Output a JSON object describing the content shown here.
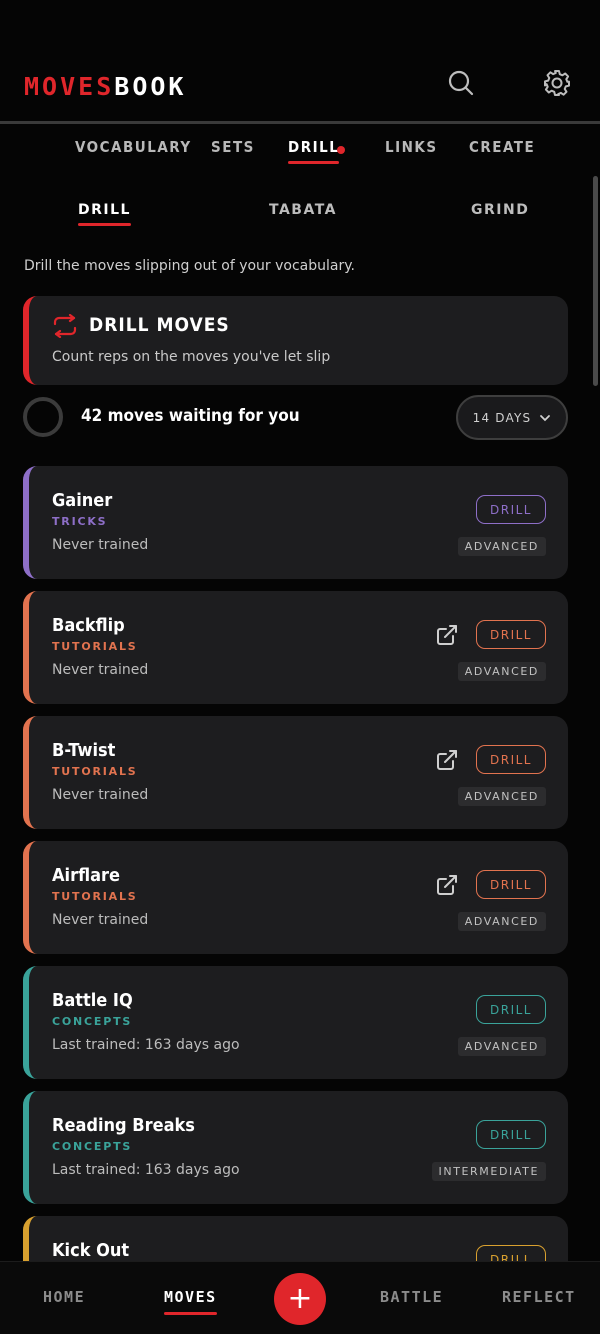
{
  "app": {
    "logo_red": "MOVES",
    "logo_white": "BOOK"
  },
  "header": {
    "search_icon": "search-icon",
    "settings_icon": "gear-icon"
  },
  "main_tabs": [
    {
      "label": "VOCABULARY"
    },
    {
      "label": "SETS"
    },
    {
      "label": "DRILL",
      "active": true,
      "badge": "dot"
    },
    {
      "label": "LINKS"
    },
    {
      "label": "CREATE"
    }
  ],
  "sub_tabs": [
    {
      "label": "DRILL",
      "active": true
    },
    {
      "label": "TABATA"
    },
    {
      "label": "GRIND"
    }
  ],
  "intro": "Drill the moves slipping out of your vocabulary.",
  "hero": {
    "title": "DRILL MOVES",
    "subtitle": "Count reps on the moves you've let slip",
    "icon": "repeat-icon"
  },
  "waiting": {
    "text": "42 moves waiting for you",
    "days_filter": "14 DAYS"
  },
  "colors": {
    "accent": "#e0262b",
    "tricks": "#8e6fc8",
    "tutorials": "#e2734f",
    "concepts": "#3aa39a",
    "footwork": "#d9a12f"
  },
  "moves": [
    {
      "name": "Gainer",
      "category": "TRICKS",
      "meta": "Never trained",
      "level": "ADVANCED",
      "drill": "DRILL",
      "external": false,
      "color": "#8e6fc8"
    },
    {
      "name": "Backflip",
      "category": "TUTORIALS",
      "meta": "Never trained",
      "level": "ADVANCED",
      "drill": "DRILL",
      "external": true,
      "color": "#e2734f"
    },
    {
      "name": "B-Twist",
      "category": "TUTORIALS",
      "meta": "Never trained",
      "level": "ADVANCED",
      "drill": "DRILL",
      "external": true,
      "color": "#e2734f"
    },
    {
      "name": "Airflare",
      "category": "TUTORIALS",
      "meta": "Never trained",
      "level": "ADVANCED",
      "drill": "DRILL",
      "external": true,
      "color": "#e2734f"
    },
    {
      "name": "Battle IQ",
      "category": "CONCEPTS",
      "meta": "Last trained: 163 days ago",
      "level": "ADVANCED",
      "drill": "DRILL",
      "external": false,
      "color": "#3aa39a"
    },
    {
      "name": "Reading Breaks",
      "category": "CONCEPTS",
      "meta": "Last trained: 163 days ago",
      "level": "INTERMEDIATE",
      "drill": "DRILL",
      "external": false,
      "color": "#3aa39a"
    },
    {
      "name": "Kick Out",
      "category": "",
      "meta": "",
      "level": "",
      "drill": "DRILL",
      "external": false,
      "color": "#d9a12f"
    }
  ],
  "bottom_nav": [
    {
      "label": "HOME"
    },
    {
      "label": "MOVES",
      "active": true
    },
    {
      "label": "BATTLE"
    },
    {
      "label": "REFLECT"
    }
  ],
  "fab": {
    "label": "+"
  }
}
